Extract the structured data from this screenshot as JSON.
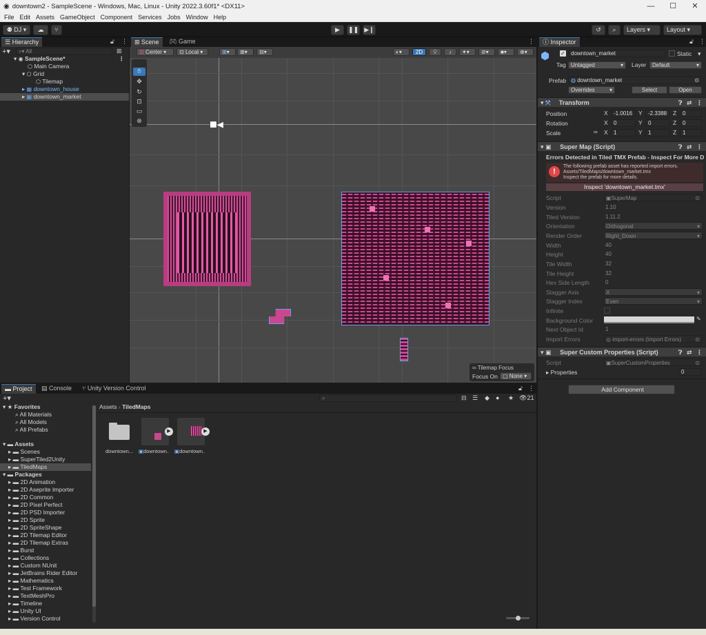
{
  "window": {
    "title": "downtown2 - SampleScene - Windows, Mac, Linux - Unity 2022.3.60f1* <DX11>"
  },
  "menu": [
    "File",
    "Edit",
    "Assets",
    "GameObject",
    "Component",
    "Services",
    "Jobs",
    "Window",
    "Help"
  ],
  "toolbar": {
    "account": "DJ",
    "layers": "Layers",
    "layout": "Layout"
  },
  "hierarchy": {
    "tab": "Hierarchy",
    "search_placeholder": "All",
    "items": [
      {
        "label": "SampleScene*",
        "indent": 0
      },
      {
        "label": "Main Camera",
        "indent": 1
      },
      {
        "label": "Grid",
        "indent": 1
      },
      {
        "label": "Tilemap",
        "indent": 2
      },
      {
        "label": "downtown_house",
        "indent": 0
      },
      {
        "label": "downtown_market",
        "indent": 0
      }
    ]
  },
  "scene": {
    "tabs": [
      "Scene",
      "Game"
    ],
    "pivot": "Center",
    "space": "Local",
    "mode_2d": "2D",
    "overlay_title": "Tilemap Focus",
    "focus_label": "Focus On",
    "focus_value": "None"
  },
  "project": {
    "tabs": [
      "Project",
      "Console",
      "Unity Version Control"
    ],
    "count": "21",
    "breadcrumb": [
      "Assets",
      "TiledMaps"
    ],
    "favorites_label": "Favorites",
    "favorites": [
      "All Materials",
      "All Models",
      "All Prefabs"
    ],
    "assets_label": "Assets",
    "assets": [
      "Scenes",
      "SuperTiled2Unity",
      "TiledMaps"
    ],
    "packages_label": "Packages",
    "packages": [
      "2D Animation",
      "2D Aseprite Importer",
      "2D Common",
      "2D Pixel Perfect",
      "2D PSD Importer",
      "2D Sprite",
      "2D SpriteShape",
      "2D Tilemap Editor",
      "2D Tilemap Extras",
      "Burst",
      "Collections",
      "Custom NUnit",
      "JetBrains Rider Editor",
      "Mathematics",
      "Test Framework",
      "TextMeshPro",
      "Timeline",
      "Unity UI",
      "Version Control"
    ],
    "grid_items": [
      "downtown...",
      "downtown...",
      "downtown..."
    ]
  },
  "inspector": {
    "tab": "Inspector",
    "name": "downtown_market",
    "static_label": "Static",
    "tag_label": "Tag",
    "tag_value": "Untagged",
    "layer_label": "Layer",
    "layer_value": "Default",
    "prefab_label": "Prefab",
    "prefab_value": "downtown_market",
    "overrides": "Overrides",
    "select": "Select",
    "open": "Open",
    "transform": {
      "title": "Transform",
      "position_label": "Position",
      "rotation_label": "Rotation",
      "scale_label": "Scale",
      "position": [
        "-1.0016",
        "-2.3388",
        "0"
      ],
      "rotation": [
        "0",
        "0",
        "0"
      ],
      "scale": [
        "1",
        "1",
        "1"
      ]
    },
    "super_map": {
      "title": "Super Map (Script)",
      "error_title": "Errors Detected in Tiled TMX Prefab - Inspect For More D",
      "error_lines": [
        "The following prefab asset has reported import errors.",
        "Assets/TiledMaps/downtown_market.tmx",
        "Inspect the prefab for more details."
      ],
      "inspect_button": "Inspect 'downtown_market.tmx'",
      "fields": [
        {
          "label": "Script",
          "value": "SuperMap"
        },
        {
          "label": "Version",
          "value": "1.10"
        },
        {
          "label": "Tiled Version",
          "value": "1.11.2"
        },
        {
          "label": "Orientation",
          "value": "Orthogonal"
        },
        {
          "label": "Render Order",
          "value": "Right_Down"
        },
        {
          "label": "Width",
          "value": "40"
        },
        {
          "label": "Height",
          "value": "40"
        },
        {
          "label": "Tile Width",
          "value": "32"
        },
        {
          "label": "Tile Height",
          "value": "32"
        },
        {
          "label": "Hex Side Length",
          "value": "0"
        },
        {
          "label": "Stagger Axis",
          "value": "X"
        },
        {
          "label": "Stagger Index",
          "value": "Even"
        },
        {
          "label": "Infinite",
          "value": ""
        },
        {
          "label": "Background Color",
          "value": ""
        },
        {
          "label": "Next Object Id",
          "value": "1"
        },
        {
          "label": "Import Errors",
          "value": "import-errors (Import Errors)"
        }
      ]
    },
    "custom_props": {
      "title": "Super Custom Properties (Script)",
      "script_label": "Script",
      "script_value": "SuperCustomProperties",
      "properties_label": "Properties",
      "properties_count": "0"
    },
    "add_component": "Add Component"
  },
  "colors": {
    "accent": "#3a79bb",
    "error": "#e04848",
    "tile_pink": "#e0509c",
    "tile_dark": "#3a1028"
  }
}
